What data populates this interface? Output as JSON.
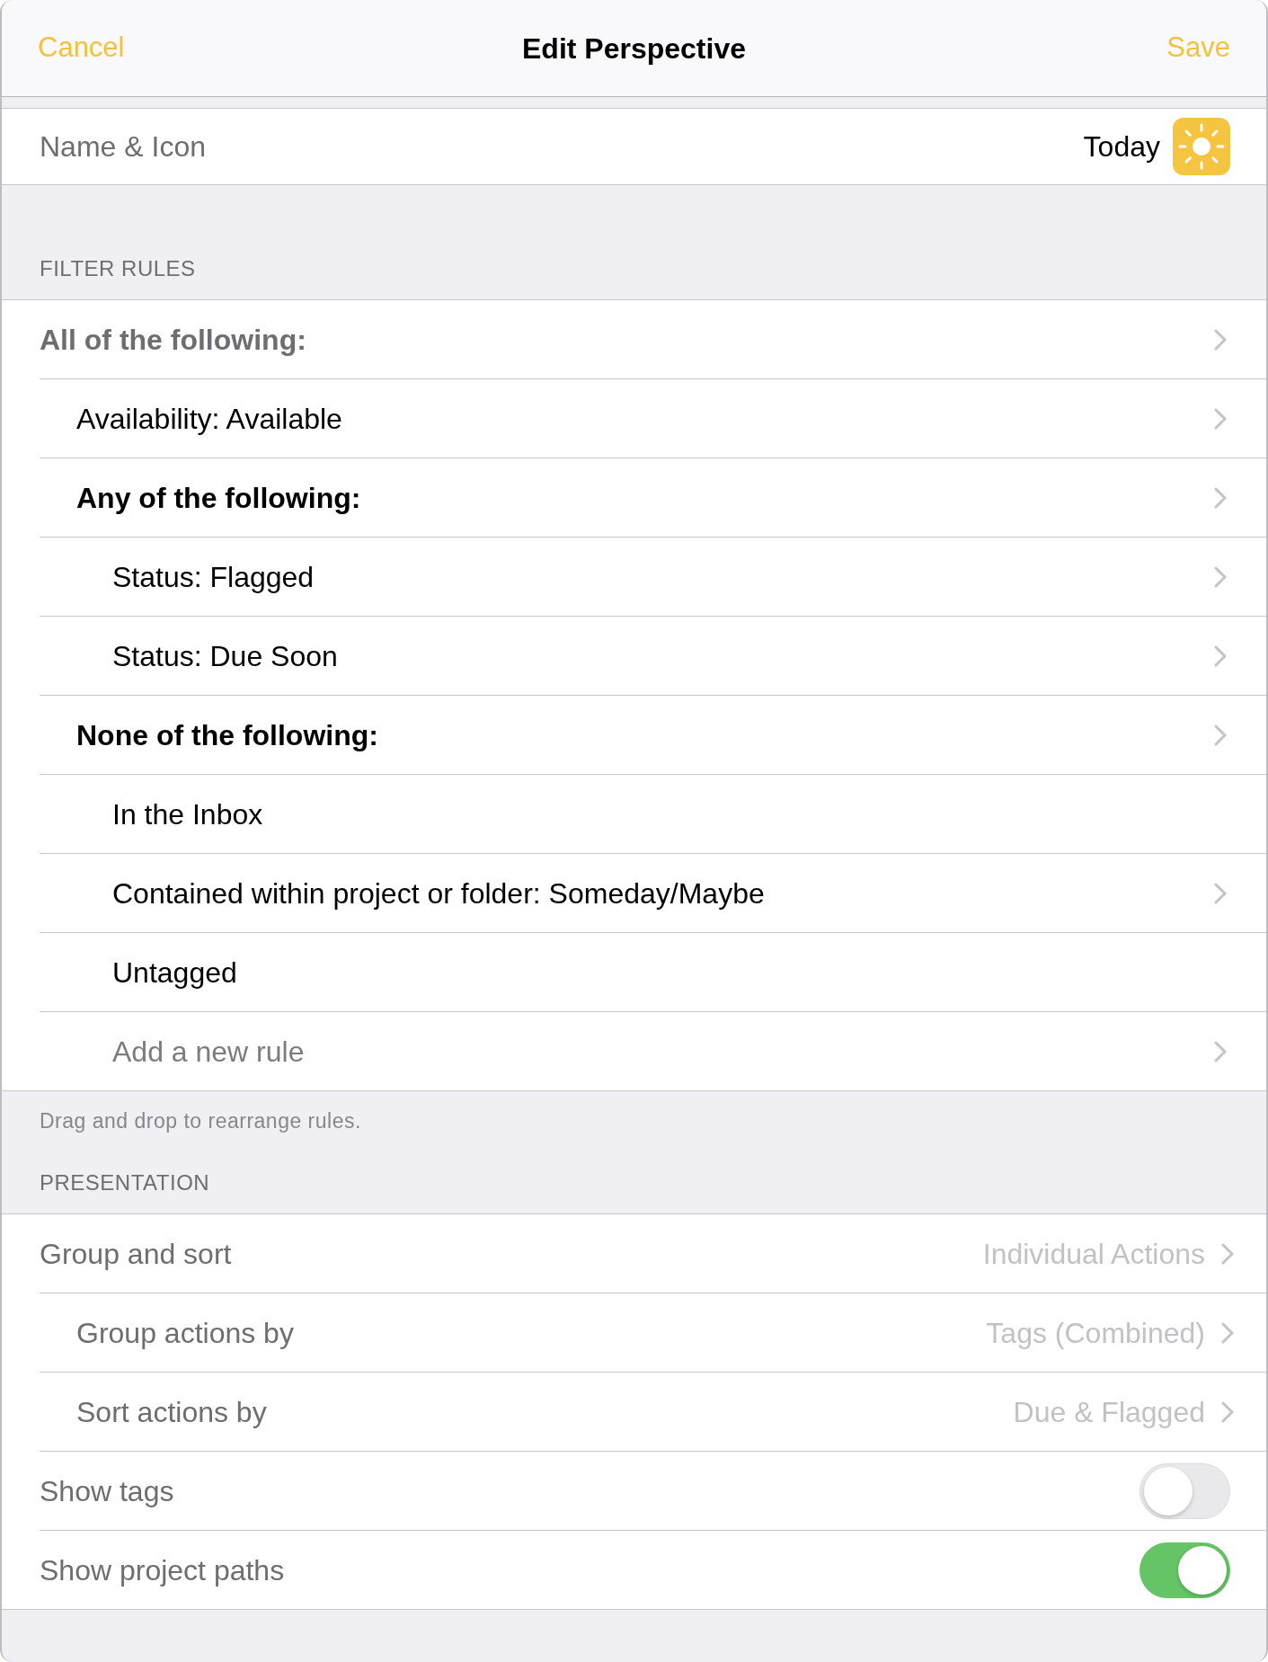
{
  "nav_bar": {
    "cancel": "Cancel",
    "title": "Edit Perspective",
    "save": "Save"
  },
  "name_icon": {
    "label": "Name & Icon",
    "value": "Today"
  },
  "filter_rules": {
    "header": "FILTER RULES",
    "rules": [
      {
        "kind": "group",
        "label": "All of the following:",
        "has_chevron": true,
        "children": [
          {
            "kind": "condition",
            "label": "Availability: Available",
            "has_chevron": true
          },
          {
            "kind": "group",
            "label": "Any of the following:",
            "has_chevron": true,
            "children": [
              {
                "kind": "condition",
                "label": "Status: Flagged",
                "has_chevron": true
              },
              {
                "kind": "condition",
                "label": "Status: Due Soon",
                "has_chevron": true
              }
            ]
          },
          {
            "kind": "group",
            "label": "None of the following:",
            "has_chevron": true,
            "children": [
              {
                "kind": "condition",
                "label": "In the Inbox",
                "has_chevron": false
              },
              {
                "kind": "condition",
                "label": "Contained within project or folder: Someday/Maybe",
                "has_chevron": true
              },
              {
                "kind": "condition",
                "label": "Untagged",
                "has_chevron": false
              },
              {
                "kind": "add",
                "label": "Add a new rule",
                "has_chevron": true
              }
            ]
          }
        ]
      }
    ],
    "footer": "Drag and drop to rearrange rules."
  },
  "presentation": {
    "header": "PRESENTATION",
    "rows": [
      {
        "kind": "picker",
        "label": "Group and sort",
        "value": "Individual Actions",
        "children": [
          {
            "kind": "picker",
            "label": "Group actions by",
            "value": "Tags (Combined)"
          },
          {
            "kind": "picker",
            "label": "Sort actions by",
            "value": "Due & Flagged"
          }
        ]
      },
      {
        "kind": "toggle",
        "label": "Show tags",
        "on": false
      },
      {
        "kind": "toggle",
        "label": "Show project paths",
        "on": true
      }
    ]
  }
}
